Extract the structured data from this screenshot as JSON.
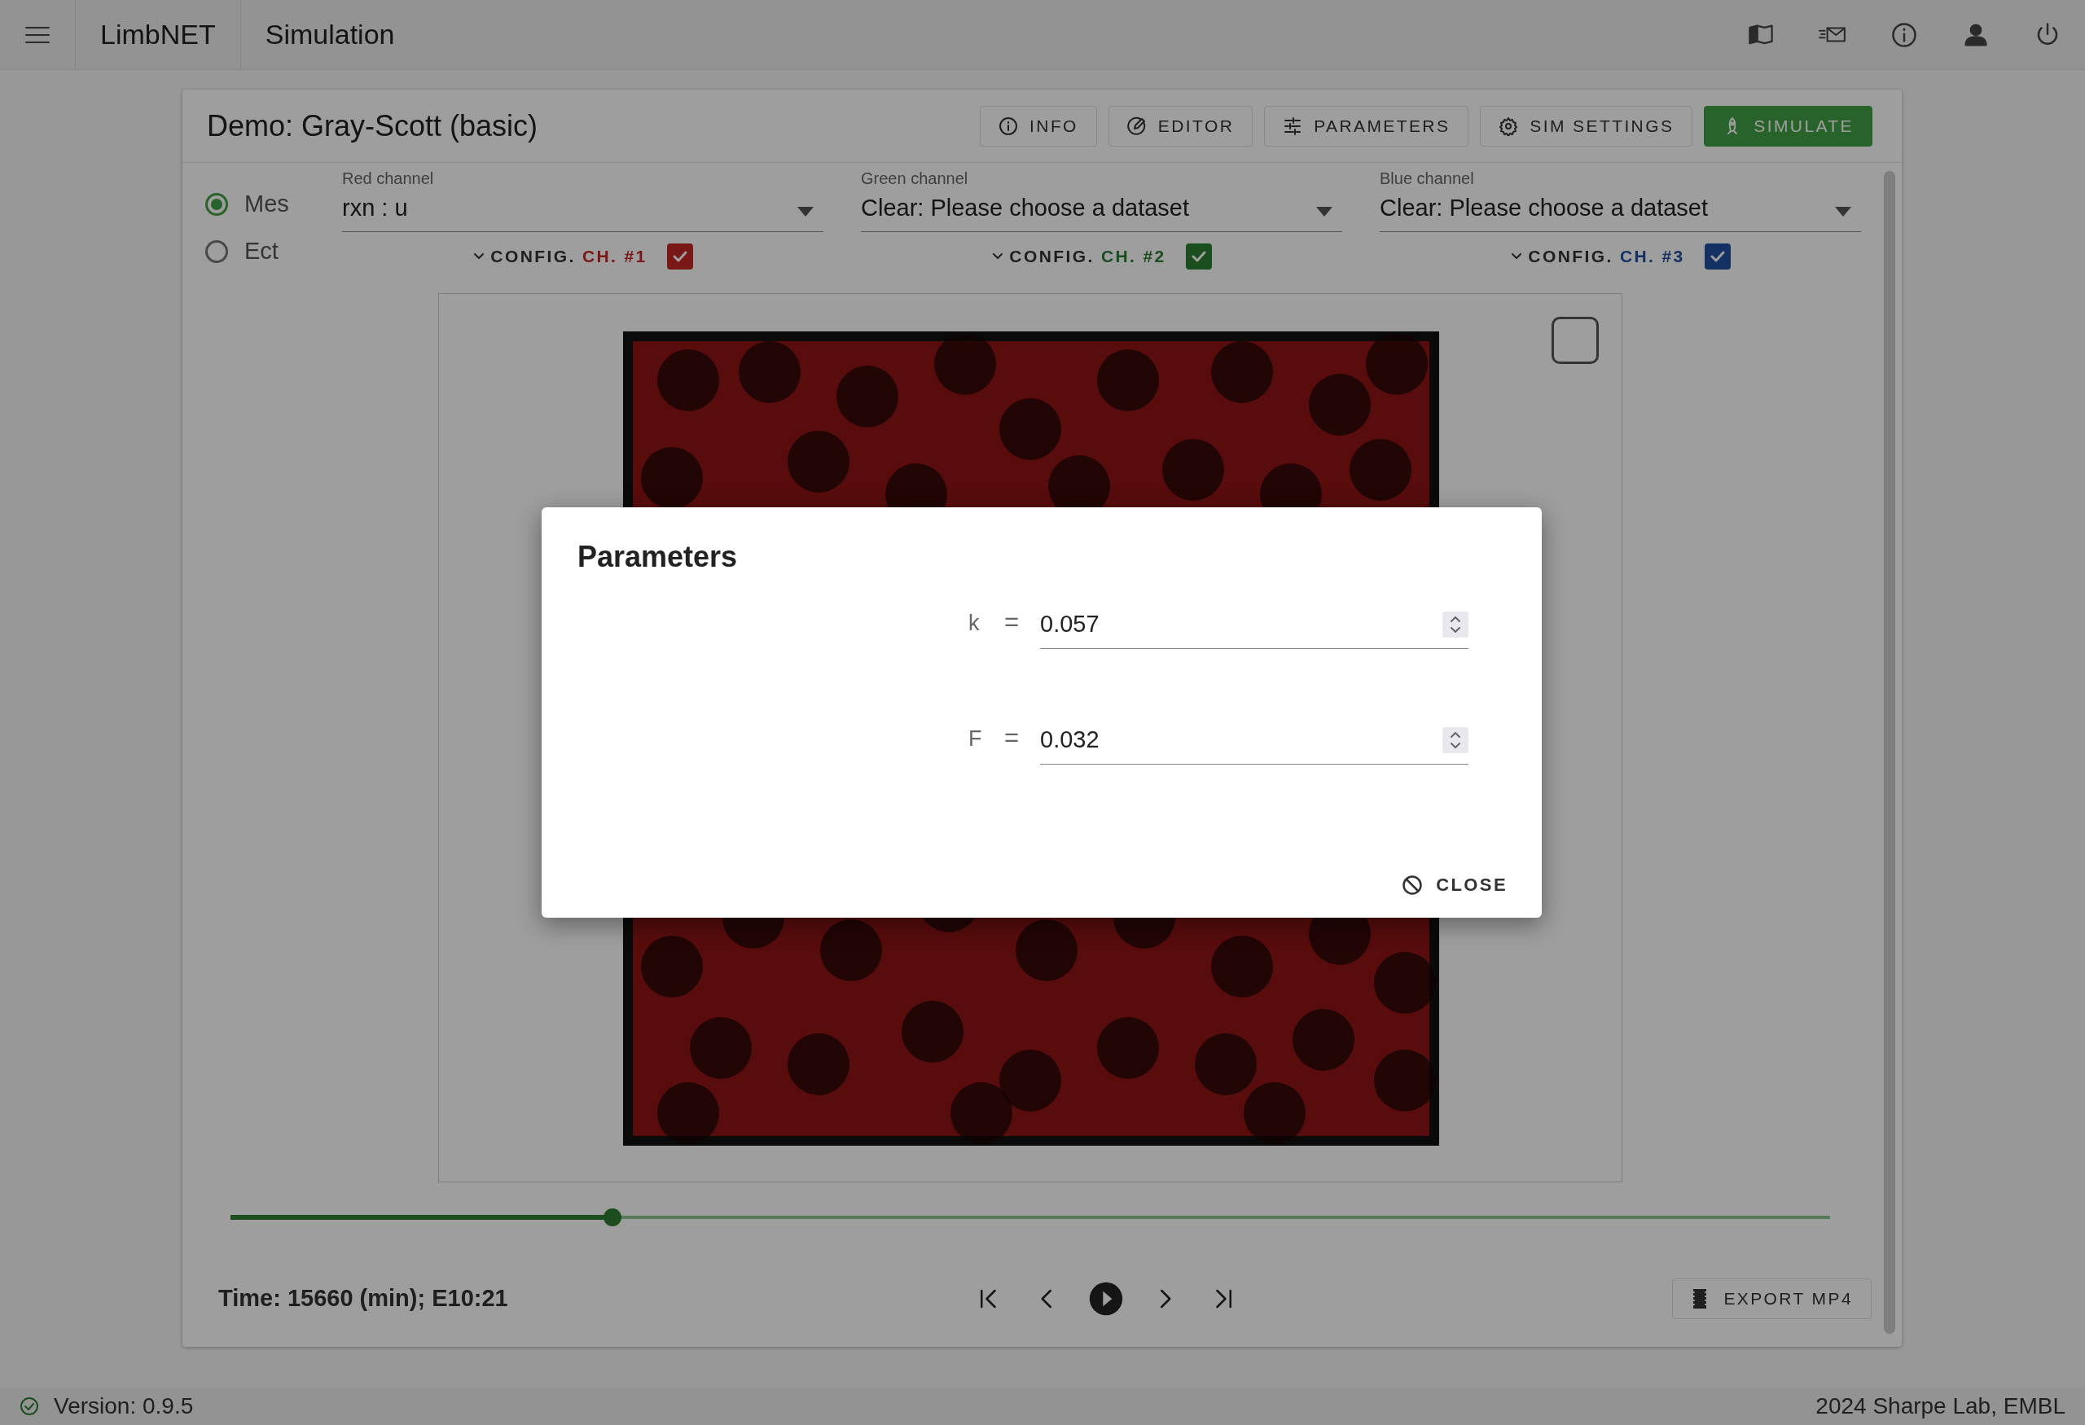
{
  "app_bar": {
    "title": "LimbNET",
    "section": "Simulation"
  },
  "card": {
    "title": "Demo: Gray-Scott (basic)",
    "actions": [
      {
        "label": "INFO",
        "kind": "info"
      },
      {
        "label": "EDITOR",
        "kind": "editor"
      },
      {
        "label": "PARAMETERS",
        "kind": "parameters"
      },
      {
        "label": "SIM SETTINGS",
        "kind": "settings"
      },
      {
        "label": "SIMULATE",
        "kind": "simulate"
      }
    ]
  },
  "tissues": [
    {
      "label": "Mes",
      "selected": true
    },
    {
      "label": "Ect",
      "selected": false
    }
  ],
  "channels": [
    {
      "label": "Red channel",
      "value": "rxn : u",
      "config": "CONFIG.",
      "channel": "CH. #1",
      "color": "#7b1919",
      "checked": true
    },
    {
      "label": "Green channel",
      "value": "Clear: Please choose a dataset",
      "config": "CONFIG.",
      "channel": "CH. #2",
      "color": "#1c4e1f",
      "checked": true
    },
    {
      "label": "Blue channel",
      "value": "Clear: Please choose a dataset",
      "config": "CONFIG.",
      "channel": "CH. #3",
      "color": "#133163",
      "checked": true
    }
  ],
  "timeline": {
    "level": 0.239
  },
  "time": "Time: 15660 (min); E10:21",
  "export": "EXPORT MP4",
  "status_bar": {
    "version": "Version: 0.9.5",
    "credit": "2024 Sharpe Lab, EMBL"
  },
  "dialog": {
    "title": "Parameters",
    "params": [
      {
        "name": "k",
        "operator": "=",
        "value": "0.057"
      },
      {
        "name": "F",
        "operator": "=",
        "value": "0.032"
      }
    ],
    "close": "CLOSE"
  }
}
